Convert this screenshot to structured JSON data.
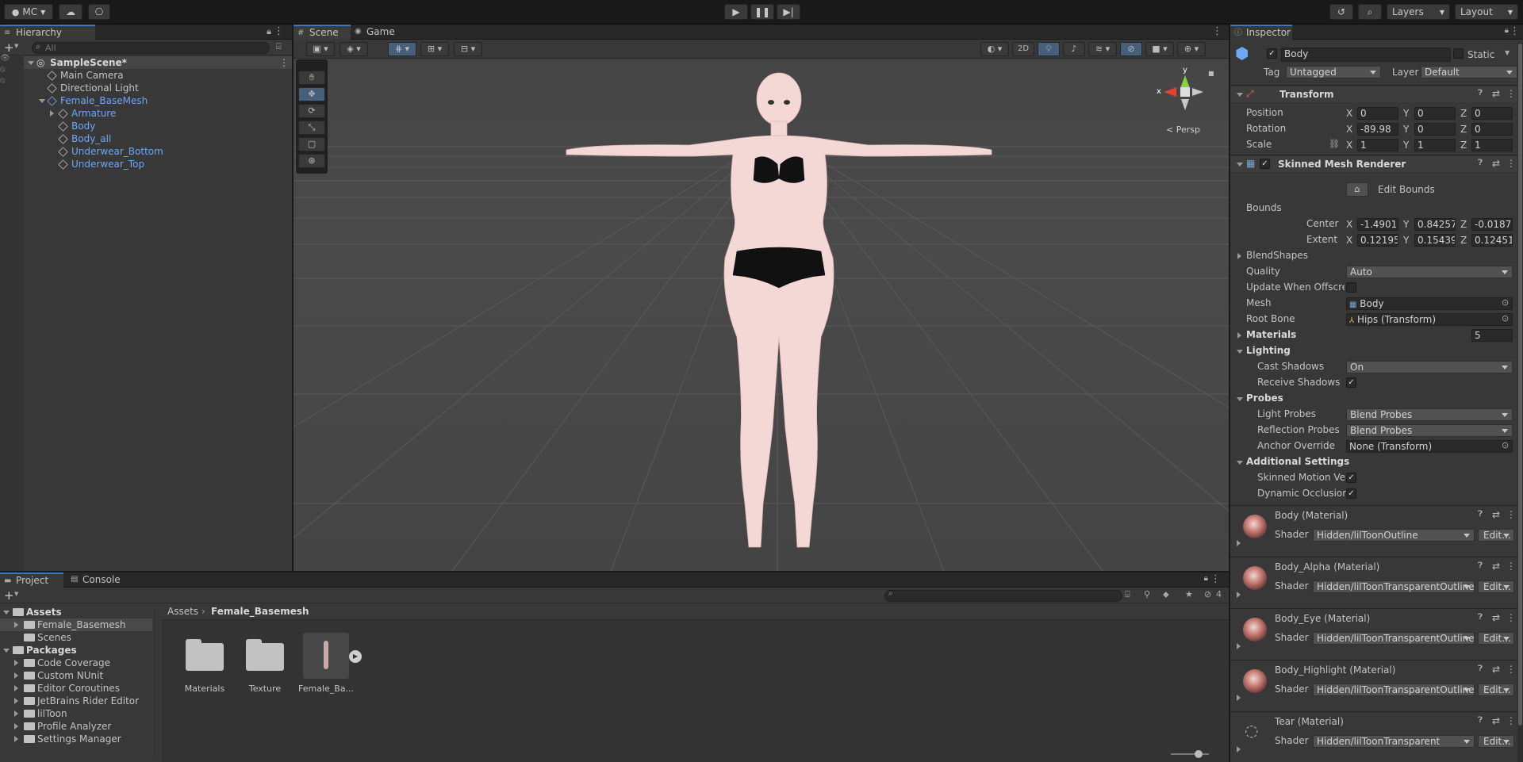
{
  "toolbar": {
    "account": "MC",
    "layers": "Layers",
    "layout": "Layout"
  },
  "hierarchy": {
    "tab": "Hierarchy",
    "search_placeholder": "All",
    "scene": "SampleScene*",
    "items": [
      {
        "label": "Main Camera"
      },
      {
        "label": "Directional Light"
      },
      {
        "label": "Female_BaseMesh"
      },
      {
        "label": "Armature"
      },
      {
        "label": "Body"
      },
      {
        "label": "Body_all"
      },
      {
        "label": "Underwear_Bottom"
      },
      {
        "label": "Underwear_Top"
      }
    ]
  },
  "scene_view": {
    "tabs": [
      "Scene",
      "Game"
    ],
    "mode_2d": "2D",
    "persp": "< Persp",
    "gizmo_x": "x",
    "gizmo_y": "y"
  },
  "project": {
    "tabs": [
      "Project",
      "Console"
    ],
    "hidden_count": "4",
    "tree": [
      {
        "label": "Assets"
      },
      {
        "label": "Female_Basemesh"
      },
      {
        "label": "Scenes"
      },
      {
        "label": "Packages"
      },
      {
        "label": "Code Coverage"
      },
      {
        "label": "Custom NUnit"
      },
      {
        "label": "Editor Coroutines"
      },
      {
        "label": "JetBrains Rider Editor"
      },
      {
        "label": "lilToon"
      },
      {
        "label": "Profile Analyzer"
      },
      {
        "label": "Settings Manager"
      }
    ],
    "breadcrumb": [
      "Assets",
      "Female_Basemesh"
    ],
    "assets": [
      {
        "label": "Materials"
      },
      {
        "label": "Texture"
      },
      {
        "label": "Female_Ba..."
      }
    ]
  },
  "inspector": {
    "tab": "Inspector",
    "object_name": "Body",
    "static_label": "Static",
    "tag_label": "Tag",
    "tag_value": "Untagged",
    "layer_label": "Layer",
    "layer_value": "Default",
    "transform": {
      "title": "Transform",
      "position_label": "Position",
      "rotation_label": "Rotation",
      "scale_label": "Scale",
      "position": [
        "0",
        "0",
        "0"
      ],
      "rotation": [
        "-89.98",
        "0",
        "0"
      ],
      "scale": [
        "1",
        "1",
        "1"
      ]
    },
    "smr": {
      "title": "Skinned Mesh Renderer",
      "edit_bounds": "Edit Bounds",
      "bounds": "Bounds",
      "center": "Center",
      "extent": "Extent",
      "center_values": [
        "-1.4901",
        "0.84257",
        "-0.0187"
      ],
      "extent_values": [
        "0.12195",
        "0.15439",
        "0.12451"
      ],
      "blendshapes": "BlendShapes",
      "quality_label": "Quality",
      "quality_value": "Auto",
      "update_offscreen": "Update When Offscree",
      "mesh_label": "Mesh",
      "mesh_value": "Body",
      "root_bone_label": "Root Bone",
      "root_bone_value": "Hips (Transform)",
      "materials_label": "Materials",
      "materials_count": "5",
      "lighting": "Lighting",
      "cast_shadows_label": "Cast Shadows",
      "cast_shadows_value": "On",
      "receive_shadows_label": "Receive Shadows",
      "probes": "Probes",
      "light_probes_label": "Light Probes",
      "light_probes_value": "Blend Probes",
      "reflection_probes_label": "Reflection Probes",
      "reflection_probes_value": "Blend Probes",
      "anchor_override_label": "Anchor Override",
      "anchor_override_value": "None (Transform)",
      "additional": "Additional Settings",
      "skinned_motion_label": "Skinned Motion Vec",
      "dynamic_occlusion_label": "Dynamic Occlusion"
    },
    "shader_label": "Shader",
    "edit_label": "Edit...",
    "axis_labels": [
      "X",
      "Y",
      "Z"
    ],
    "materials": [
      {
        "name": "Body (Material)",
        "shader": "Hidden/lilToonOutline"
      },
      {
        "name": "Body_Alpha (Material)",
        "shader": "Hidden/lilToonTransparentOutline"
      },
      {
        "name": "Body_Eye (Material)",
        "shader": "Hidden/lilToonTransparentOutline"
      },
      {
        "name": "Body_Highlight (Material)",
        "shader": "Hidden/lilToonTransparentOutline"
      },
      {
        "name": "Tear (Material)",
        "shader": "Hidden/lilToonTransparent"
      }
    ]
  }
}
